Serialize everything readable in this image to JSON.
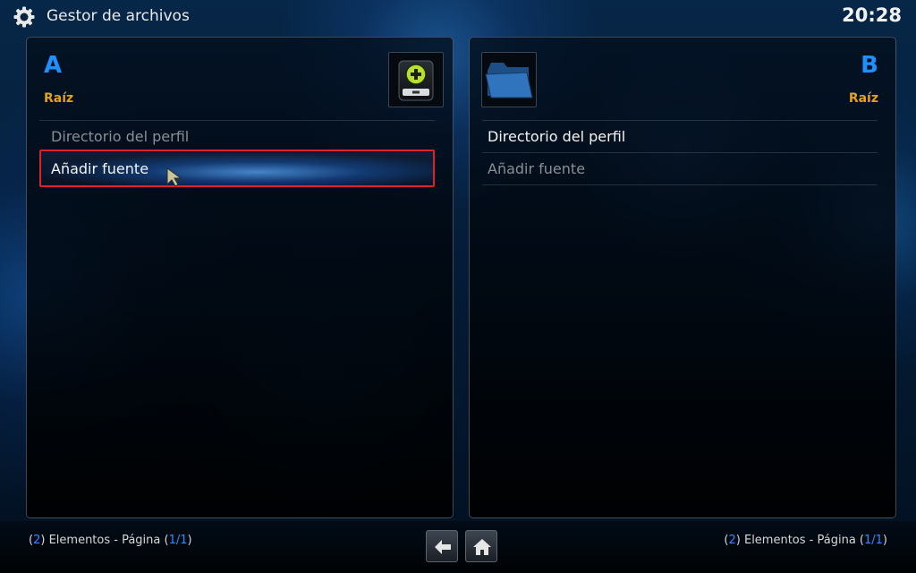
{
  "header": {
    "title": "Gestor de archivos",
    "clock": "20:28",
    "icon": "gear-icon"
  },
  "pane_a": {
    "letter": "A",
    "subtitle": "Raíz",
    "thumbnail_icon": "add-source-drive-icon",
    "items": [
      {
        "label": "Directorio del perfil"
      },
      {
        "label": "Añadir fuente"
      }
    ],
    "focused_item": 1,
    "status": {
      "count": "2",
      "elements_text": "Elementos - Página",
      "page": "1/1"
    }
  },
  "pane_b": {
    "letter": "B",
    "subtitle": "Raíz",
    "thumbnail_icon": "folder-icon",
    "items": [
      {
        "label": "Directorio del perfil"
      },
      {
        "label": "Añadir fuente"
      }
    ],
    "status": {
      "count": "2",
      "elements_text": "Elementos - Página",
      "page": "1/1"
    }
  },
  "nav": {
    "back_icon": "back-arrow-icon",
    "home_icon": "home-icon"
  },
  "colors": {
    "accent_blue": "#1e90ff",
    "subtitle_orange": "#e3a21a",
    "highlight_red": "#e0202a"
  }
}
